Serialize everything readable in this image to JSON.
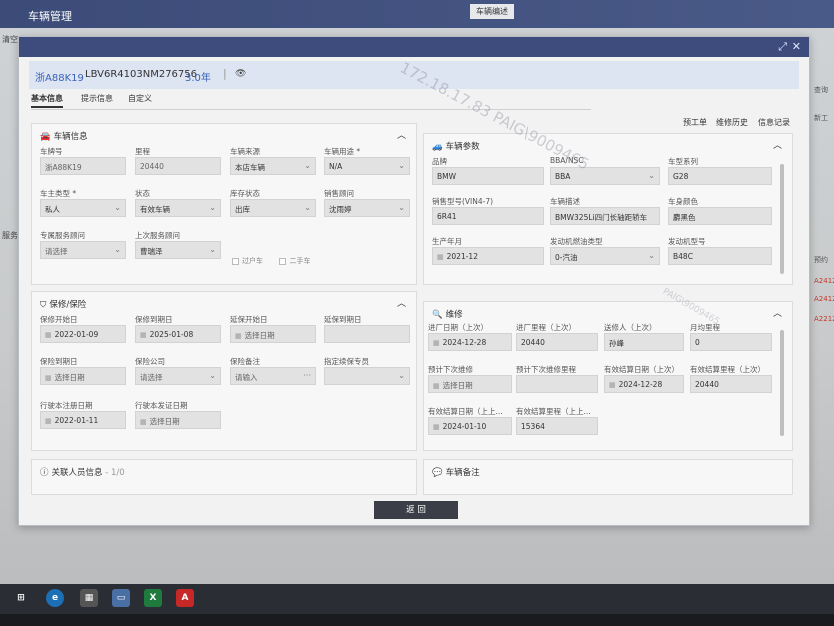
{
  "app": {
    "title": "车辆管理",
    "bg_tab": "车辆编述",
    "left_labels": [
      "清空",
      "服务"
    ],
    "right_labels": [
      "查询",
      "新工",
      "预约",
      "A2412",
      "A2412",
      "A2212"
    ]
  },
  "vehicle": {
    "plate": "浙A88K19",
    "vin": "LBV6R4103NM276756",
    "age": "3.0年",
    "sep": "|",
    "eye_icon": "eye-icon"
  },
  "tabs": [
    "基本信息",
    "提示信息",
    "自定义"
  ],
  "actions": [
    "预工单",
    "维修历史",
    "信息记录"
  ],
  "watermark": "172.18.17.83  PAIG\\9009465",
  "watermark2": "PAIG\\9009465",
  "vehicle_info": {
    "title": "车辆信息",
    "fields": [
      {
        "label": "车牌号",
        "value": "浙A88K19"
      },
      {
        "label": "里程",
        "value": "20440"
      },
      {
        "label": "车辆来源",
        "value": "本店车辆"
      },
      {
        "label": "车辆用途 *",
        "value": "N/A"
      },
      {
        "label": "车主类型 *",
        "value": "私人"
      },
      {
        "label": "状态",
        "value": "有效车辆"
      },
      {
        "label": "库存状态",
        "value": "出库"
      },
      {
        "label": "销售顾问",
        "value": "沈雨婷"
      },
      {
        "label": "专属服务顾问",
        "value": "请选择"
      },
      {
        "label": "上次服务顾问",
        "value": "曹瑞泽"
      }
    ],
    "checks": [
      "过户车",
      "二手车"
    ]
  },
  "vehicle_params": {
    "title": "车辆参数",
    "fields": [
      {
        "label": "品牌",
        "value": "BMW"
      },
      {
        "label": "BBA/NSC",
        "value": "BBA"
      },
      {
        "label": "车型系列",
        "value": "G28"
      },
      {
        "label": "销售型号(VIN4-7)",
        "value": "6R41"
      },
      {
        "label": "车辆描述",
        "value": "BMW325Li四门长轴距轿车"
      },
      {
        "label": "车身颜色",
        "value": "麝黑色"
      },
      {
        "label": "生产年月",
        "value": "2021-12"
      },
      {
        "label": "发动机燃油类型",
        "value": "0-汽油"
      },
      {
        "label": "发动机型号",
        "value": "B48C"
      }
    ]
  },
  "warranty": {
    "title": "保修/保险",
    "fields": [
      {
        "label": "保修开始日",
        "value": "2022-01-09"
      },
      {
        "label": "保修到期日",
        "value": "2025-01-08"
      },
      {
        "label": "延保开始日",
        "value": "选择日期"
      },
      {
        "label": "延保到期日",
        "value": ""
      },
      {
        "label": "保险到期日",
        "value": "选择日期"
      },
      {
        "label": "保险公司",
        "value": "请选择"
      },
      {
        "label": "保险备注",
        "value": "请输入"
      },
      {
        "label": "指定续保专员",
        "value": ""
      },
      {
        "label": "行驶本注册日期",
        "value": "2022-01-11"
      },
      {
        "label": "行驶本发证日期",
        "value": "选择日期"
      }
    ]
  },
  "repair": {
    "title": "维修",
    "fields": [
      {
        "label": "进厂日期（上次）",
        "value": "2024-12-28"
      },
      {
        "label": "进厂里程（上次）",
        "value": "20440"
      },
      {
        "label": "送修人（上次）",
        "value": "孙峰"
      },
      {
        "label": "月均里程",
        "value": "0"
      },
      {
        "label": "预计下次维修",
        "value": "选择日期"
      },
      {
        "label": "预计下次维修里程",
        "value": ""
      },
      {
        "label": "有效结算日期（上次）",
        "value": "2024-12-28"
      },
      {
        "label": "有效结算里程（上次）",
        "value": "20440"
      },
      {
        "label": "有效结算日期（上上...",
        "value": "2024-01-10"
      },
      {
        "label": "有效结算里程（上上...",
        "value": "15364"
      }
    ]
  },
  "related_people": {
    "title": "关联人员信息",
    "count": "- 1/0"
  },
  "vehicle_notes": {
    "title": "车辆备注"
  },
  "return_label": "返 回",
  "taskbar": [
    "任务视图",
    "浏览器",
    "计算器",
    "远程桌面",
    "X",
    "PDF"
  ],
  "colors": {
    "modal_bar": "#3d4c7c",
    "link_blue": "#3a63b8",
    "button_dark": "#3b3e46"
  }
}
